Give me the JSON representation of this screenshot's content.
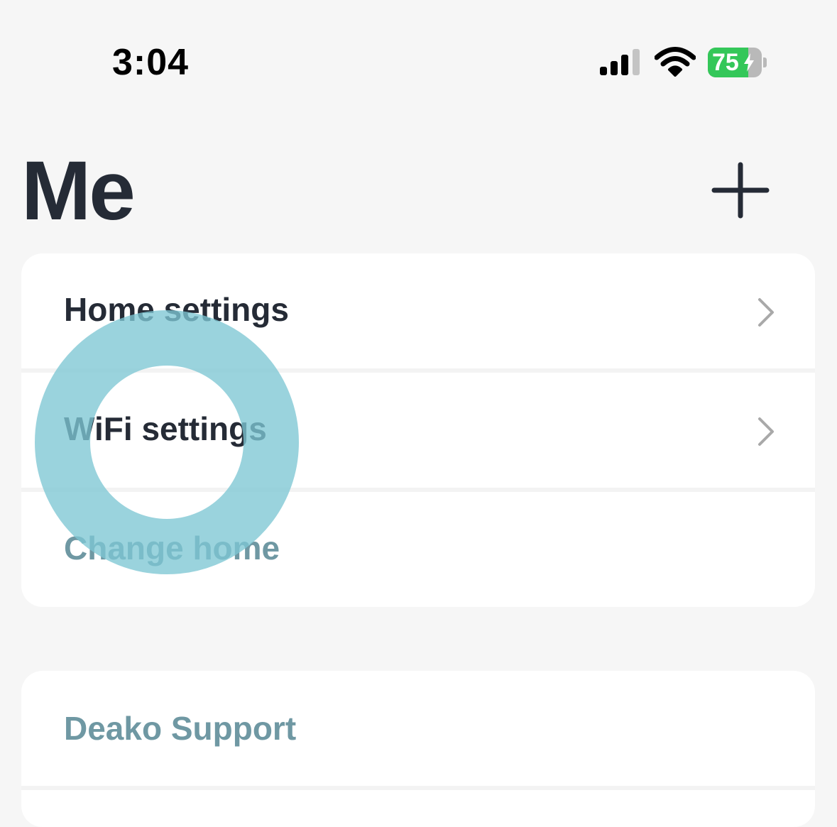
{
  "status_bar": {
    "time": "3:04",
    "battery_percent": "75",
    "battery_level": 0.75,
    "signal_icon": "cellular-signal-icon",
    "wifi_icon": "wifi-icon",
    "charging_icon": "bolt-icon"
  },
  "header": {
    "title": "Me",
    "add_icon": "plus-icon"
  },
  "settings_card": {
    "items": [
      {
        "label": "Home settings",
        "chevron": true
      },
      {
        "label": "WiFi settings",
        "chevron": true
      },
      {
        "label": "Change home",
        "chevron": false
      }
    ]
  },
  "support_card": {
    "items": [
      {
        "label": "Deako Support"
      }
    ]
  },
  "colors": {
    "background": "#f6f6f6",
    "card": "#ffffff",
    "text_dark": "#252b36",
    "text_muted": "#6f98a3",
    "chevron": "#a9a9a9",
    "battery_green": "#34c759",
    "tap_indicator": "#7ec7d3"
  }
}
